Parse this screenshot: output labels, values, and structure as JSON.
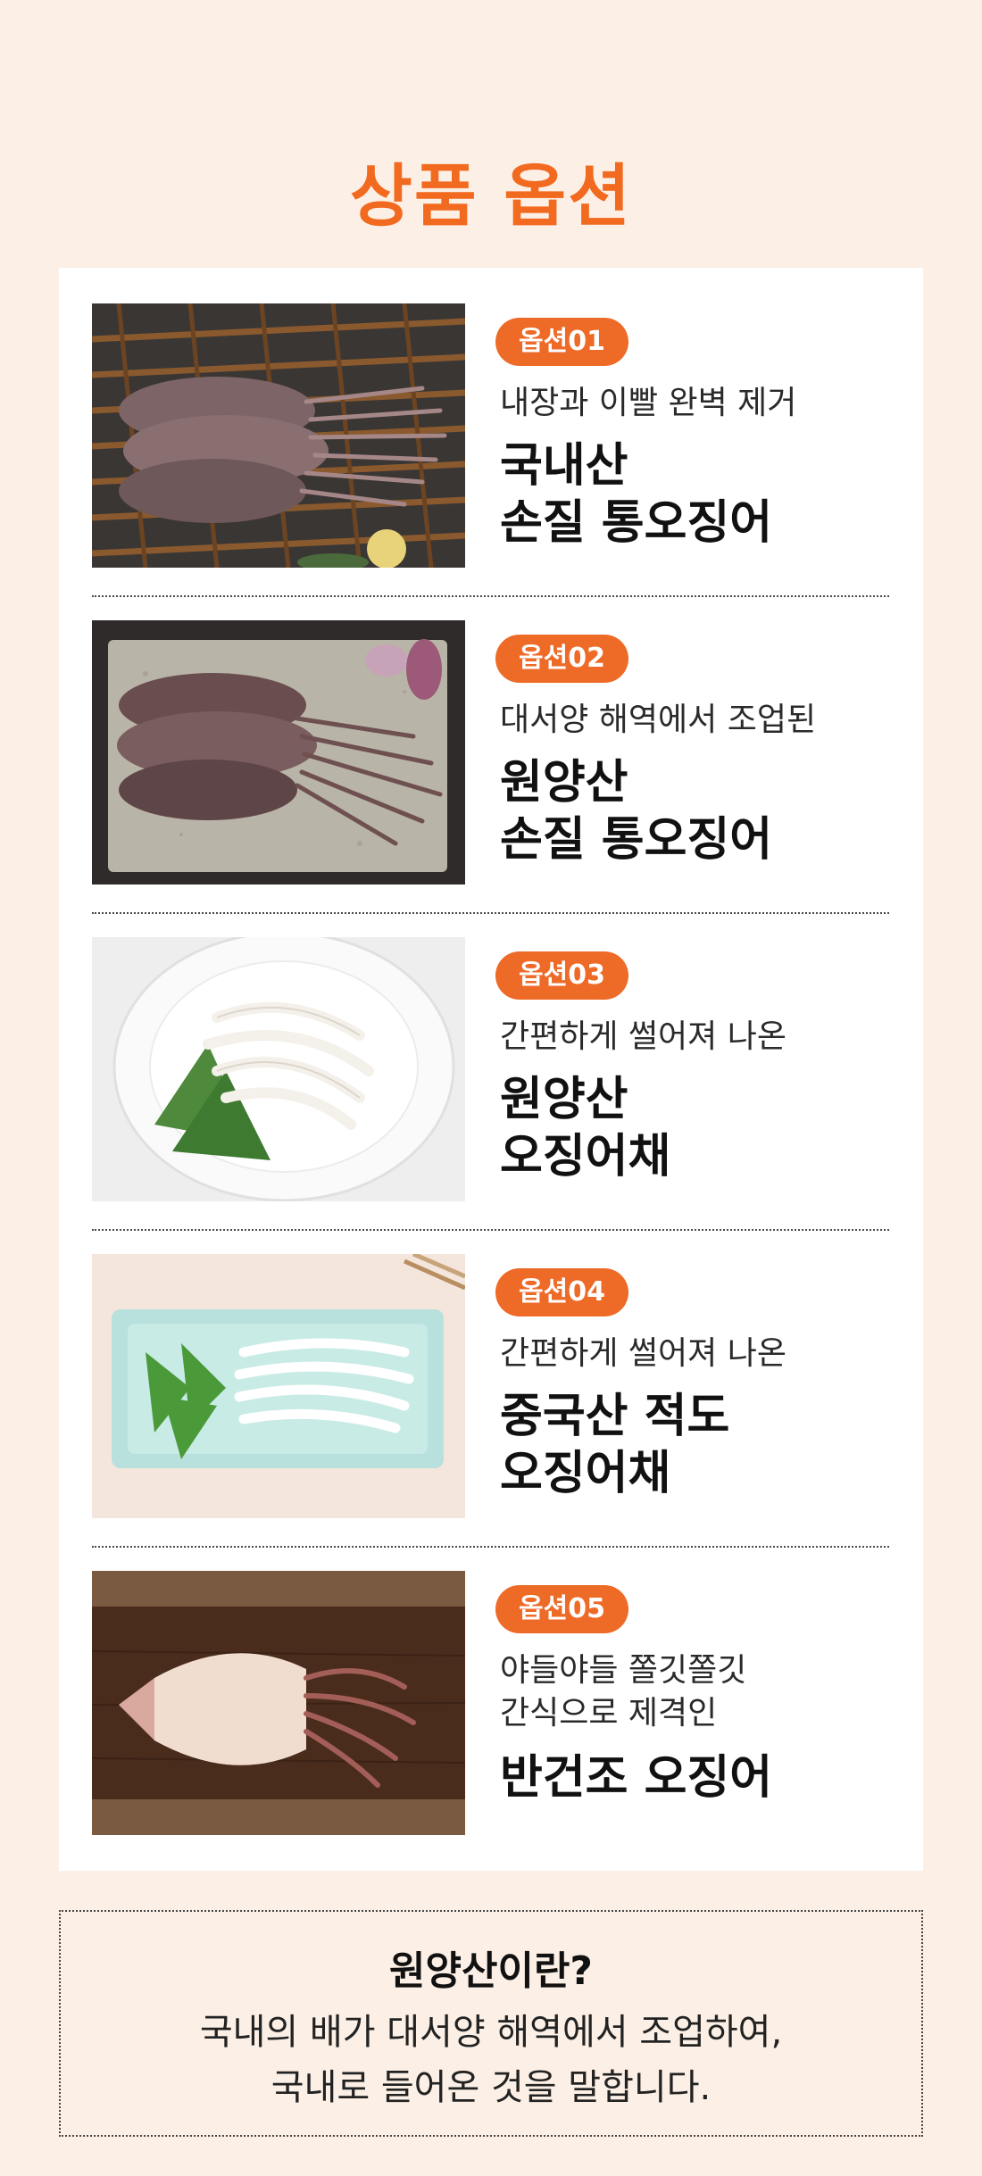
{
  "page": {
    "title": "상품 옵션"
  },
  "options": [
    {
      "badge": "옵션01",
      "desc": [
        "내장과 이빨 완벽 제거"
      ],
      "name": [
        "국내산",
        "손질 통오징어"
      ],
      "image": "whole-squid-on-bamboo-rack-photo"
    },
    {
      "badge": "옵션02",
      "desc": [
        "대서양 해역에서 조업된"
      ],
      "name": [
        "원양산",
        "손질 통오징어"
      ],
      "image": "whole-squid-on-stone-plate-photo"
    },
    {
      "badge": "옵션03",
      "desc": [
        "간편하게 썰어져 나온"
      ],
      "name": [
        "원양산",
        "오징어채"
      ],
      "image": "sliced-squid-white-plate-photo"
    },
    {
      "badge": "옵션04",
      "desc": [
        "간편하게 썰어져 나온"
      ],
      "name": [
        "중국산 적도",
        "오징어채"
      ],
      "image": "sliced-squid-mint-dish-photo"
    },
    {
      "badge": "옵션05",
      "desc": [
        "야들야들 쫄깃쫄깃",
        "간식으로 제격인"
      ],
      "name": [
        "반건조 오징어"
      ],
      "image": "dried-squid-wooden-board-photo"
    }
  ],
  "notice": {
    "title": "원양산이란?",
    "lines": [
      "국내의 배가 대서양 해역에서 조업하여,",
      "국내로 들어온 것을 말합니다."
    ]
  },
  "colors": {
    "background": "#fcf0e6",
    "accent": "#f26a1f",
    "badge": "#ee6a27"
  }
}
